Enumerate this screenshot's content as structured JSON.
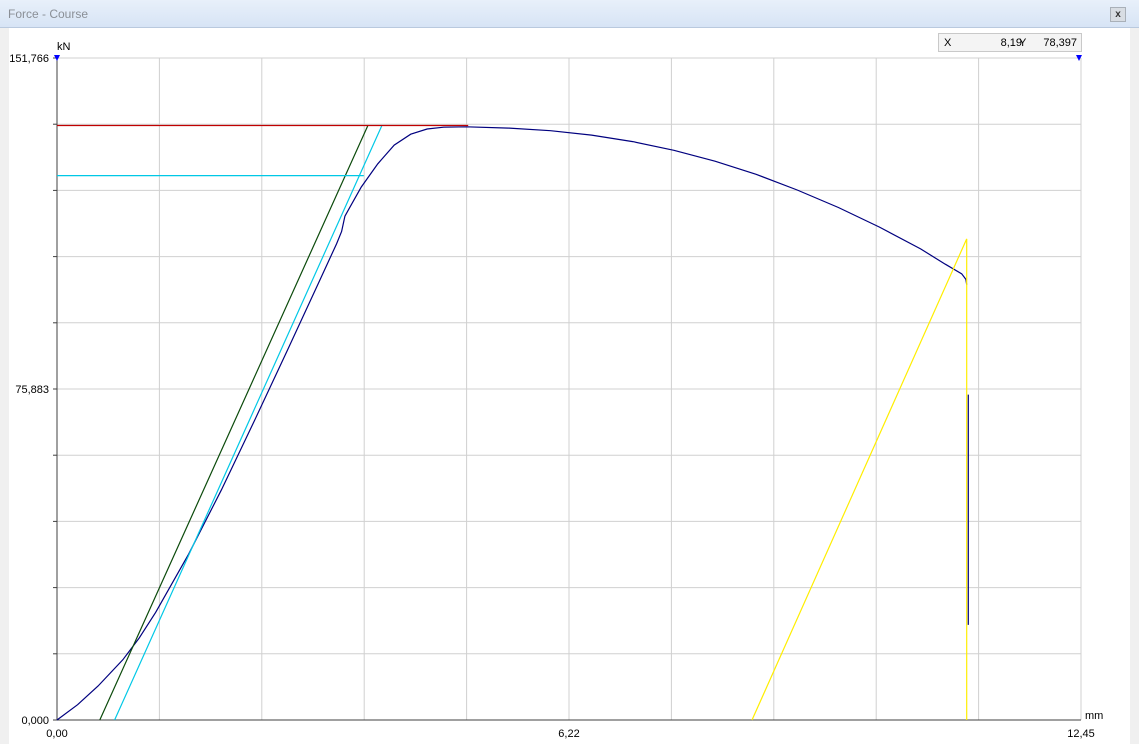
{
  "window": {
    "title": "Force - Course",
    "close_label": "x"
  },
  "readout": {
    "x_label": "X",
    "x_value": "8,19",
    "y_label": "Y",
    "y_value": "78,397"
  },
  "colors": {
    "main_curve": "#00007f",
    "tangent": "#0b4a0b",
    "offset_line": "#00c8e6",
    "max_line": "#c00000",
    "break_line": "#ffee00",
    "grid": "#d0d0d0",
    "marker": "#0000ff"
  },
  "chart_data": {
    "type": "line",
    "xlabel": "mm",
    "ylabel": "kN",
    "xlim": [
      0,
      12.45
    ],
    "ylim": [
      0,
      151.766
    ],
    "x_ticks_labeled": [
      "0,00",
      "6,22",
      "12,45"
    ],
    "y_ticks_labeled": [
      "0,000",
      "75,883",
      "151,766"
    ],
    "x_gridlines": [
      0,
      1.245,
      2.49,
      3.735,
      4.98,
      6.225,
      7.47,
      8.715,
      9.96,
      11.205,
      12.45
    ],
    "y_gridlines": [
      0,
      15.177,
      30.353,
      45.53,
      60.706,
      75.883,
      91.06,
      106.236,
      121.413,
      136.589,
      151.766
    ],
    "grid": true,
    "series": [
      {
        "key": "main_curve",
        "x": [
          0,
          0.25,
          0.5,
          0.8,
          1.0,
          1.2,
          1.6,
          2.0,
          2.4,
          2.8,
          3.2,
          3.4,
          3.46,
          3.5,
          3.55,
          3.7,
          3.9,
          4.1,
          4.3,
          4.5,
          4.7,
          4.98,
          5.5,
          6.0,
          6.5,
          7.0,
          7.5,
          8.0,
          8.5,
          9.0,
          9.5,
          10.0,
          10.5,
          10.8,
          11.0,
          11.05,
          11.06
        ],
        "y": [
          0,
          3.5,
          7.8,
          13.8,
          18.8,
          24.7,
          38.0,
          52.8,
          68.6,
          84.7,
          101.0,
          109.2,
          112.0,
          115.5,
          117.2,
          122.2,
          127.5,
          131.8,
          134.3,
          135.5,
          135.9,
          136.0,
          135.7,
          135.1,
          134.1,
          132.6,
          130.6,
          128.1,
          125.1,
          121.5,
          117.5,
          113.0,
          108.0,
          104.5,
          102.3,
          101.0,
          99.8
        ]
      },
      {
        "key": "tangent",
        "x": [
          0.52,
          3.78
        ],
        "y": [
          0,
          136.3
        ]
      },
      {
        "key": "offset_line",
        "x": [
          0.7,
          3.95
        ],
        "y": [
          0,
          136.3
        ]
      },
      {
        "key": "offset_line",
        "x": [
          0,
          3.73
        ],
        "y": [
          124.8,
          124.8
        ]
      },
      {
        "key": "max_line",
        "x": [
          0,
          5.0
        ],
        "y": [
          136.3,
          136.3
        ]
      },
      {
        "key": "break_line",
        "x": [
          8.45,
          11.06
        ],
        "y": [
          0,
          110.3
        ]
      },
      {
        "key": "break_line",
        "x": [
          11.06,
          11.06
        ],
        "y": [
          110.3,
          0
        ]
      },
      {
        "key": "main_curve",
        "x": [
          11.08,
          11.08
        ],
        "y": [
          74.6,
          21.8
        ]
      }
    ]
  }
}
